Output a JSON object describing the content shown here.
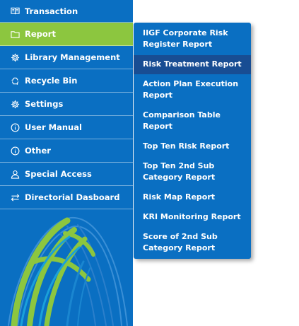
{
  "sidebar": {
    "items": [
      {
        "label": "Transaction",
        "icon": "book-icon",
        "active": false
      },
      {
        "label": "Report",
        "icon": "folder-icon",
        "active": true
      },
      {
        "label": "Library Management",
        "icon": "gear-icon",
        "active": false
      },
      {
        "label": "Recycle Bin",
        "icon": "recycle-icon",
        "active": false
      },
      {
        "label": "Settings",
        "icon": "gear-icon",
        "active": false
      },
      {
        "label": "User Manual",
        "icon": "info-icon",
        "active": false
      },
      {
        "label": "Other",
        "icon": "info-icon",
        "active": false
      },
      {
        "label": "Special Access",
        "icon": "user-icon",
        "active": false
      },
      {
        "label": "Directorial Dasboard",
        "icon": "swap-arrows-icon",
        "active": false
      }
    ]
  },
  "report_menu": {
    "items": [
      {
        "label": "IIGF Corporate Risk Register Report",
        "highlighted": false
      },
      {
        "label": "Risk Treatment Report",
        "highlighted": true
      },
      {
        "label": "Action Plan Execution Report",
        "highlighted": false
      },
      {
        "label": "Comparison Table Report",
        "highlighted": false
      },
      {
        "label": "Top Ten Risk Report",
        "highlighted": false
      },
      {
        "label": "Top Ten 2nd Sub Category Report",
        "highlighted": false
      },
      {
        "label": "Risk Map Report",
        "highlighted": false
      },
      {
        "label": "KRI Monitoring Report",
        "highlighted": false
      },
      {
        "label": "Score of 2nd Sub Category Report",
        "highlighted": false
      }
    ]
  },
  "colors": {
    "sidebar_bg": "#0a6fc2",
    "active_bg": "#8cc63f",
    "highlight_bg": "#184d93",
    "text": "#ffffff"
  }
}
